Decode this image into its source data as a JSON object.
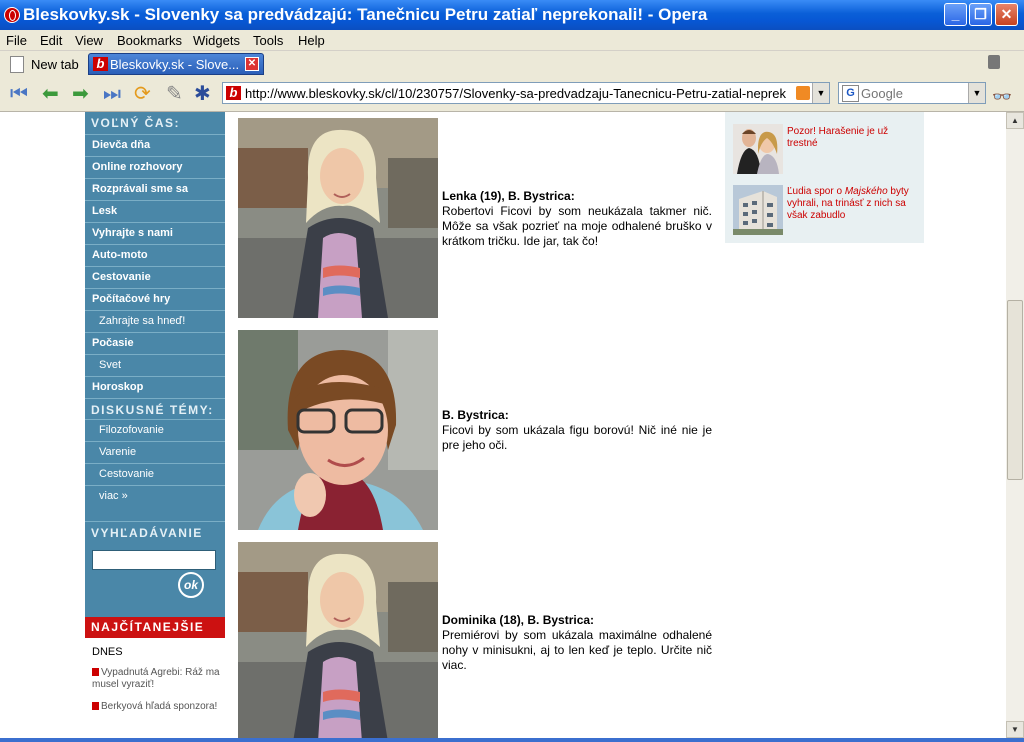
{
  "window": {
    "title": "Bleskovky.sk - Slovenky sa predvádzajú: Tanečnicu Petru zatiaľ neprekonali! - Opera"
  },
  "menu": [
    "File",
    "Edit",
    "View",
    "Bookmarks",
    "Widgets",
    "Tools",
    "Help"
  ],
  "tabs": {
    "new_tab": "New tab",
    "active": "Bleskovky.sk - Slove..."
  },
  "address": {
    "url": "http://www.bleskovky.sk/cl/10/230757/Slovenky-sa-predvadzaju-Tanecnicu-Petru-zatial-neprek"
  },
  "search": {
    "placeholder": "Google"
  },
  "sidebar": {
    "volny_cas": "VOĽNÝ ČAS:",
    "items": [
      {
        "label": "Dievča dňa"
      },
      {
        "label": "Online rozhovory"
      },
      {
        "label": "Rozprávali sme sa"
      },
      {
        "label": "Lesk"
      },
      {
        "label": "Vyhrajte s nami"
      },
      {
        "label": "Auto-moto"
      },
      {
        "label": "Cestovanie"
      },
      {
        "label": "Počítačové hry"
      },
      {
        "label": "Zahrajte sa hneď!"
      },
      {
        "label": "Počasie"
      },
      {
        "label": "Svet"
      },
      {
        "label": "Horoskop"
      }
    ],
    "diskusne": "DISKUSNÉ TÉMY:",
    "topics": [
      {
        "label": "Filozofovanie"
      },
      {
        "label": "Varenie"
      },
      {
        "label": "Cestovanie"
      },
      {
        "label": "viac »"
      }
    ],
    "vyhladavanie": "VYHĽADÁVANIE",
    "ok": "ok",
    "najcitanejsie": "NAJČÍTANEJŠIE",
    "dnes": "DNES",
    "top": [
      {
        "label": "Vypadnutá Agrebi: Ráž ma musel vyraziť!"
      },
      {
        "label": "Berkyová hľadá sponzora!"
      }
    ]
  },
  "quotes": [
    {
      "name": "Lenka (19), B. Bystrica:",
      "text": "Robertovi Ficovi by som neukázala takmer nič. Môže sa však pozrieť na moje odhalené bruško v krátkom tričku. Ide jar, tak čo!"
    },
    {
      "name": "B. Bystrica:",
      "text": "Ficovi by som ukázala figu borovú! Nič iné nie je pre jeho oči."
    },
    {
      "name": "Dominika (18), B. Bystrica:",
      "text": "Premiérovi by som ukázala maximálne odhalené nohy v minisukni, aj to len keď je teplo. Určite nič viac."
    }
  ],
  "related": [
    {
      "text": "Pozor! Harašenie je už trestné"
    },
    {
      "pre": "Ľudia spor o ",
      "em": "Majského",
      "post": " byty vyhrali, na trinásť z nich sa však zabudlo"
    }
  ]
}
